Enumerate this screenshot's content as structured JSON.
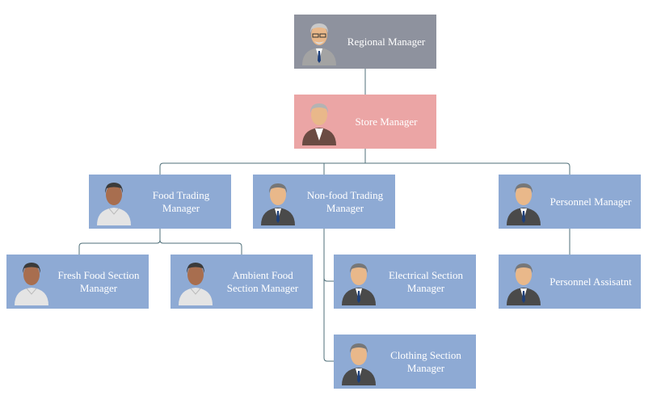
{
  "colors": {
    "root": "#8e929e",
    "store": "#eba5a5",
    "staff": "#8eaad4",
    "connector": "#4f6f78"
  },
  "nodes": [
    {
      "id": "regional",
      "label": "Regional Manager",
      "avatar": "senior-man-glasses-icon",
      "color": "root"
    },
    {
      "id": "store",
      "label": "Store Manager",
      "avatar": "gray-hair-man-brown-suit-icon",
      "color": "store"
    },
    {
      "id": "food",
      "label": "Food Trading Manager",
      "avatar": "man-white-shirt-icon",
      "color": "staff",
      "parent": "store"
    },
    {
      "id": "nonfood",
      "label": "Non-food Trading Manager",
      "avatar": "businessman-icon",
      "color": "staff",
      "parent": "store"
    },
    {
      "id": "personnel",
      "label": "Personnel Manager",
      "avatar": "businessman-icon",
      "color": "staff",
      "parent": "store"
    },
    {
      "id": "fresh",
      "label": "Fresh Food Section Manager",
      "avatar": "man-white-shirt-icon",
      "color": "staff",
      "parent": "food"
    },
    {
      "id": "ambient",
      "label": "Ambient Food Section Manager",
      "avatar": "man-white-shirt-icon",
      "color": "staff",
      "parent": "food"
    },
    {
      "id": "electrical",
      "label": "Electrical Section Manager",
      "avatar": "businessman-icon",
      "color": "staff",
      "parent": "nonfood"
    },
    {
      "id": "clothing",
      "label": "Clothing Section Manager",
      "avatar": "businessman-icon",
      "color": "staff",
      "parent": "nonfood"
    },
    {
      "id": "assistant",
      "label": "Personnel Assisatnt",
      "avatar": "businessman-icon",
      "color": "staff",
      "parent": "personnel"
    }
  ]
}
